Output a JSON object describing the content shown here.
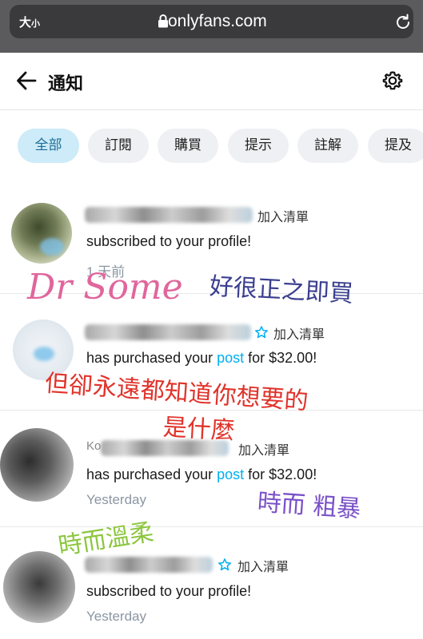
{
  "browser": {
    "text_size_label": "大",
    "text_size_small": "小",
    "url": "onlyfans.com"
  },
  "header": {
    "title": "通知"
  },
  "tabs": [
    {
      "label": "全部",
      "active": true
    },
    {
      "label": "訂閱",
      "active": false
    },
    {
      "label": "購買",
      "active": false
    },
    {
      "label": "提示",
      "active": false
    },
    {
      "label": "註解",
      "active": false
    },
    {
      "label": "提及",
      "active": false
    }
  ],
  "notifications": [
    {
      "add_to_list": "加入清單",
      "message": "subscribed to your profile!",
      "time": "1 天前"
    },
    {
      "add_to_list": "加入清單",
      "message_before": "has purchased your ",
      "link": "post",
      "message_after": " for $32.00!",
      "time": ""
    },
    {
      "name_fragment": "Ko",
      "add_to_list": "加入清單",
      "message_before": "has purchased your ",
      "link": "post",
      "message_after": " for $32.00!",
      "time": "Yesterday"
    },
    {
      "add_to_list": "加入清單",
      "message": "subscribed to your profile!",
      "time": "Yesterday"
    }
  ],
  "overlay": {
    "signature": "Dr Some",
    "line1": "好很正之即買",
    "line2": "但卻永遠都知道你想要的",
    "line3": "是什麼",
    "line4": "時而 粗暴",
    "line5": "時而溫柔"
  },
  "colors": {
    "accent": "#00aff0",
    "active_tab_bg": "#cdebf8",
    "signature": "#e0669c",
    "overlay_red": "#e0332b",
    "overlay_purple": "#7a52c8",
    "overlay_green": "#8cc63f",
    "overlay_navy": "#3b3f8f"
  }
}
